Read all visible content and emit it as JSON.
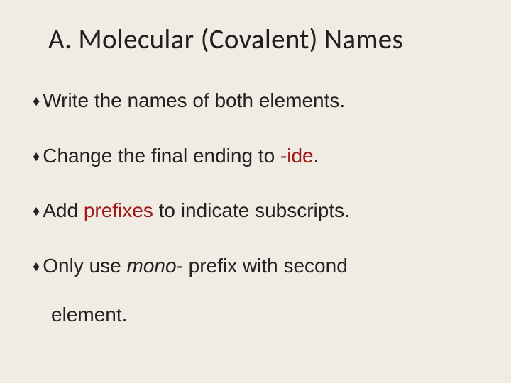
{
  "title": "A. Molecular  (Covalent) Names",
  "bullets": [
    {
      "lead": "Write",
      "rest": " the names of both elements."
    },
    {
      "lead": "Change",
      "rest_before": " the final ending to ",
      "red": "-ide",
      "rest_after": "."
    },
    {
      "lead": "Add",
      "rest_before": " ",
      "red": "prefixes",
      "rest_after": " to indicate subscripts."
    },
    {
      "lead": "Only",
      "rest_before": " use ",
      "ital": "mono-",
      "rest_after": " prefix with second",
      "cont": "element."
    }
  ],
  "bullet_char": "♦"
}
